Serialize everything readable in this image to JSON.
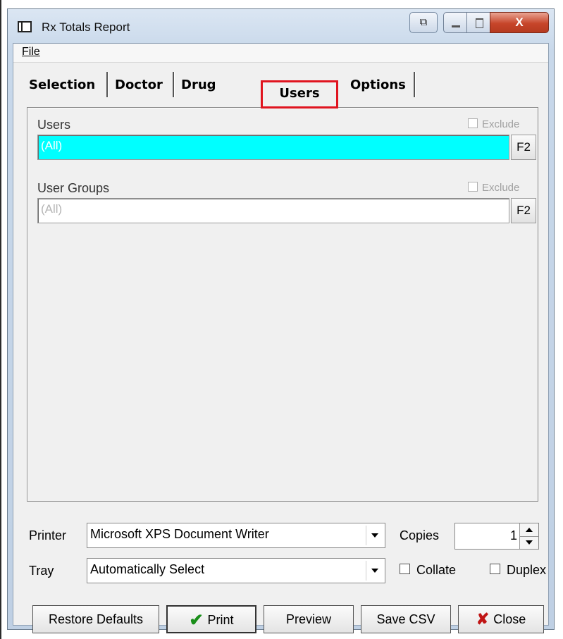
{
  "window": {
    "title": "Rx Totals Report"
  },
  "menu": {
    "file": "File"
  },
  "tabs": [
    {
      "label": "Selection"
    },
    {
      "label": "Doctor"
    },
    {
      "label": "Drug"
    },
    {
      "label": "Users",
      "selected": true
    },
    {
      "label": "Options"
    }
  ],
  "users_panel": {
    "users_label": "Users",
    "users_exclude": "Exclude",
    "users_value": "(All)",
    "users_lookup": "F2",
    "groups_label": "User Groups",
    "groups_exclude": "Exclude",
    "groups_value": "(All)",
    "groups_lookup": "F2"
  },
  "printer": {
    "printer_label": "Printer",
    "printer_value": "Microsoft XPS Document Writer",
    "tray_label": "Tray",
    "tray_value": "Automatically Select",
    "copies_label": "Copies",
    "copies_value": "1",
    "collate_label": "Collate",
    "duplex_label": "Duplex"
  },
  "buttons": {
    "restore": "Restore Defaults",
    "print": "Print",
    "preview": "Preview",
    "save_csv": "Save CSV",
    "close": "Close"
  },
  "colors": {
    "active_field": "#00ffff",
    "highlight_box": "#e0141f"
  }
}
